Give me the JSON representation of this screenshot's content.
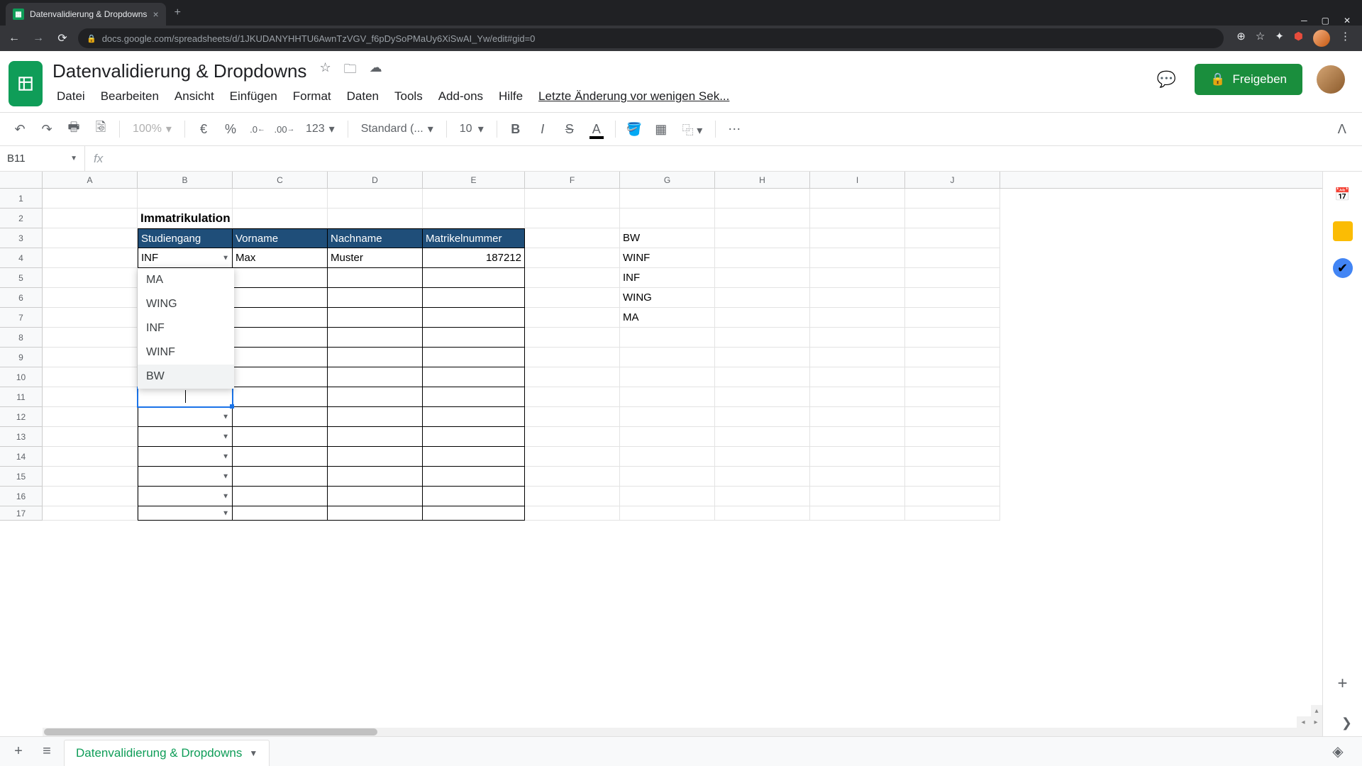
{
  "browser": {
    "tab_title": "Datenvalidierung & Dropdowns",
    "url": "docs.google.com/spreadsheets/d/1JKUDANYHHTU6AwnTzVGV_f6pDySoPMaUy6XiSwAI_Yw/edit#gid=0"
  },
  "doc": {
    "title": "Datenvalidierung & Dropdowns",
    "last_edit": "Letzte Änderung vor wenigen Sek...",
    "share_label": "Freigeben"
  },
  "menu": {
    "file": "Datei",
    "edit": "Bearbeiten",
    "view": "Ansicht",
    "insert": "Einfügen",
    "format": "Format",
    "data": "Daten",
    "tools": "Tools",
    "addons": "Add-ons",
    "help": "Hilfe"
  },
  "toolbar": {
    "zoom": "100%",
    "currency": "€",
    "percent": "%",
    "dec_less": ".0",
    "dec_more": ".00",
    "numfmt": "123",
    "font": "Standard (...",
    "fontsize": "10"
  },
  "namebox": "B11",
  "columns": [
    "A",
    "B",
    "C",
    "D",
    "E",
    "F",
    "G",
    "H",
    "I",
    "J"
  ],
  "sheet": {
    "title_row2": "Immatrikulation",
    "headers": {
      "b": "Studiengang",
      "c": "Vorname",
      "d": "Nachname",
      "e": "Matrikelnummer"
    },
    "row4": {
      "b": "INF",
      "c": "Max",
      "d": "Muster",
      "e": "187212"
    },
    "g_list": {
      "g3": "BW",
      "g4": "WINF",
      "g5": "INF",
      "g6": "WING",
      "g7": "MA"
    }
  },
  "dropdown_options": [
    "MA",
    "WING",
    "INF",
    "WINF",
    "BW"
  ],
  "sheet_tab": "Datenvalidierung & Dropdowns"
}
